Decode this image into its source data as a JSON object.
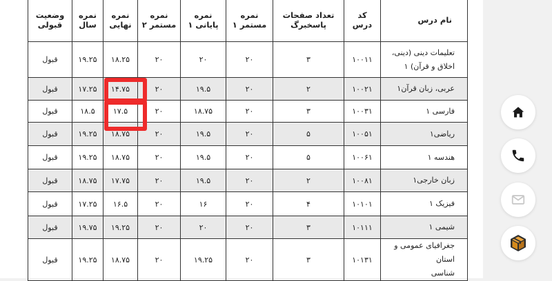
{
  "table": {
    "headers": {
      "course_name": "نام درس",
      "code": [
        "کد",
        "درس"
      ],
      "answer_pages": [
        "تعداد صفحات",
        "پاسخبرگ"
      ],
      "cont1": [
        "نمره",
        "مستمر ۱"
      ],
      "final1": [
        "نمره",
        "پایانی ۱"
      ],
      "cont2": [
        "نمره",
        "مستمر ۲"
      ],
      "final": [
        "نمره",
        "نهایی"
      ],
      "year": [
        "نمره",
        "سال"
      ],
      "status": [
        "وضعیت",
        "قبولی"
      ]
    },
    "rows": [
      {
        "name": [
          "تعلیمات دینی (دینی،",
          "اخلاق و قرآن) ۱"
        ],
        "code": "۱۰۰۱۱",
        "pages": "۳",
        "cont1": "۲۰",
        "final1": "۲۰",
        "cont2": "۲۰",
        "final": "۱۸.۲۵",
        "year": "۱۹.۲۵",
        "status": "قبول"
      },
      {
        "name": [
          "عربی، زبان قرآن۱"
        ],
        "code": "۱۰۰۲۱",
        "pages": "۲",
        "cont1": "۲۰",
        "final1": "۱۹.۵",
        "cont2": "۲۰",
        "final": "۱۴.۷۵",
        "year": "۱۷.۲۵",
        "status": "قبول"
      },
      {
        "name": [
          "فارسی ۱"
        ],
        "code": "۱۰۰۳۱",
        "pages": "۳",
        "cont1": "۲۰",
        "final1": "۱۸.۷۵",
        "cont2": "۲۰",
        "final": "۱۷.۵",
        "year": "۱۸.۵",
        "status": "قبول"
      },
      {
        "name": [
          "ریاضی۱"
        ],
        "code": "۱۰۰۵۱",
        "pages": "۵",
        "cont1": "۲۰",
        "final1": "۱۹.۵",
        "cont2": "۲۰",
        "final": "۱۸.۷۵",
        "year": "۱۹.۲۵",
        "status": "قبول"
      },
      {
        "name": [
          "هندسه ۱"
        ],
        "code": "۱۰۰۶۱",
        "pages": "۵",
        "cont1": "۲۰",
        "final1": "۱۹.۵",
        "cont2": "۲۰",
        "final": "۱۸.۷۵",
        "year": "۱۹.۲۵",
        "status": "قبول"
      },
      {
        "name": [
          "زبان خارجی۱"
        ],
        "code": "۱۰۰۸۱",
        "pages": "۲",
        "cont1": "۲۰",
        "final1": "۱۹.۵",
        "cont2": "۲۰",
        "final": "۱۷.۷۵",
        "year": "۱۸.۷۵",
        "status": "قبول"
      },
      {
        "name": [
          "فیزیک ۱"
        ],
        "code": "۱۰۱۰۱",
        "pages": "۴",
        "cont1": "۲۰",
        "final1": "۱۶",
        "cont2": "۲۰",
        "final": "۱۶.۵",
        "year": "۱۷.۲۵",
        "status": "قبول"
      },
      {
        "name": [
          "شیمی ۱"
        ],
        "code": "۱۰۱۱۱",
        "pages": "۳",
        "cont1": "۲۰",
        "final1": "۲۰",
        "cont2": "۲۰",
        "final": "۱۹.۲۵",
        "year": "۱۹.۷۵",
        "status": "قبول"
      },
      {
        "name": [
          "جغرافیای عمومی و استان",
          "شناسی"
        ],
        "code": "۱۰۱۳۱",
        "pages": "۳",
        "cont1": "۲۰",
        "final1": "۱۹.۲۵",
        "cont2": "۲۰",
        "final": "۱۸.۷۵",
        "year": "۱۹.۲۵",
        "status": "قبول"
      }
    ]
  },
  "side_actions": [
    {
      "icon": "home-icon",
      "color": "#1a1a1a"
    },
    {
      "icon": "phone-icon",
      "color": "#1a1a1a"
    },
    {
      "icon": "mail-icon",
      "color": "#c9c9c9"
    },
    {
      "icon": "package-icon",
      "color": "#d58a1c"
    }
  ],
  "highlight_color": "#ee2b2b"
}
